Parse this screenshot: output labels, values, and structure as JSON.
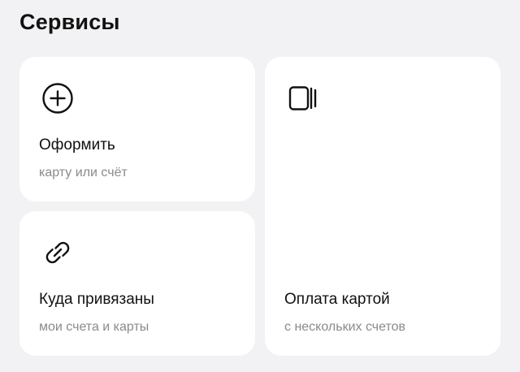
{
  "section": {
    "title": "Сервисы"
  },
  "cards": [
    {
      "icon": "plus-circle-icon",
      "title": "Оформить",
      "subtitle": "карту или счёт"
    },
    {
      "icon": "link-icon",
      "title": "Куда привязаны",
      "subtitle": "мои счета и карты"
    },
    {
      "icon": "cards-stack-icon",
      "title": "Оплата картой",
      "subtitle": "с нескольких счетов"
    }
  ]
}
